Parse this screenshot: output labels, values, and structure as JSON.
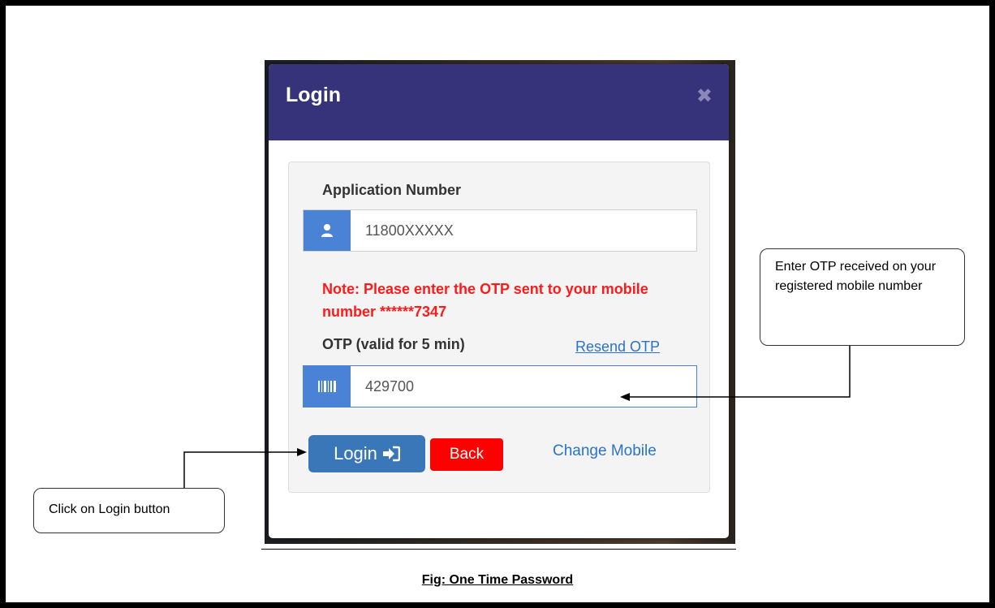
{
  "modal": {
    "title": "Login",
    "close_symbol": "✖"
  },
  "form": {
    "application_number_label": "Application Number",
    "application_number_value": "11800XXXXX",
    "note": "Note: Please enter the OTP sent to your mobile number  ******7347",
    "otp_label": "OTP (valid for 5 min)",
    "resend_otp": "Resend OTP",
    "otp_value": "429700",
    "login_button": "Login",
    "back_button": "Back",
    "change_mobile": "Change Mobile"
  },
  "icons": {
    "user": "user-icon",
    "barcode": "barcode-icon",
    "login_arrow": "sign-in-icon",
    "close": "close-icon"
  },
  "callouts": {
    "otp": "Enter OTP received on your registered mobile number",
    "login": "Click on Login button"
  },
  "caption": "Fig: One Time Password",
  "colors": {
    "header": "#37337a",
    "note": "#ff1a1a",
    "login_button": "#3a77b8",
    "back_button": "#ff0000",
    "addon": "#4a82d6",
    "link": "#2a74c8"
  }
}
